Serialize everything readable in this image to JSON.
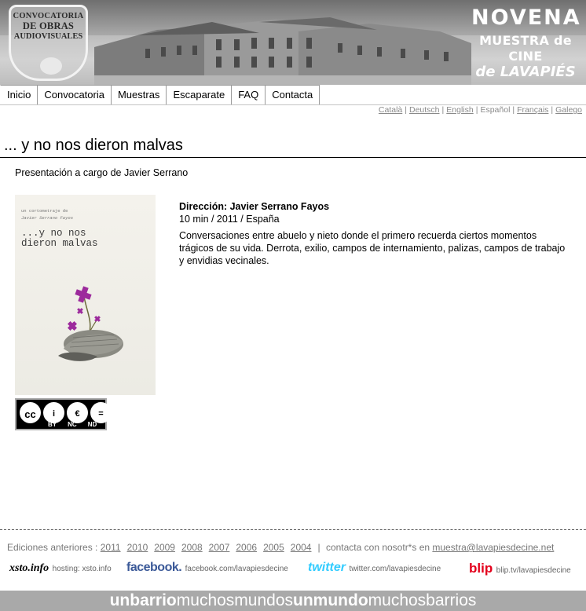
{
  "banner": {
    "badge_line1": "CONVOCATORIA",
    "badge_line2": "DE OBRAS",
    "badge_line3": "AUDIOVISUALES",
    "novena_line1": "NOVENA",
    "novena_line2": "MUESTRA de CINE",
    "novena_line3": "de LAVAPIÉS"
  },
  "nav": {
    "items": [
      {
        "label": "Inicio"
      },
      {
        "label": "Convocatoria"
      },
      {
        "label": "Muestras"
      },
      {
        "label": "Escaparate"
      },
      {
        "label": "FAQ"
      },
      {
        "label": "Contacta"
      }
    ]
  },
  "languages": {
    "items": [
      {
        "label": "Català"
      },
      {
        "label": "Deutsch"
      },
      {
        "label": "English"
      },
      {
        "label": "Español"
      },
      {
        "label": "Français"
      },
      {
        "label": "Galego"
      }
    ],
    "separator": "|"
  },
  "film": {
    "title": "... y no nos dieron malvas",
    "presentation": "Presentación a cargo de Javier Serrano",
    "direction": "Dirección: Javier Serrano Fayos",
    "meta": "10 min / 2011 / España",
    "description": "Conversaciones entre abuelo y nieto donde el primero recuerda ciertos momentos trágicos de su vida. Derrota, exilio, campos de internamiento, palizas, campos de trabajo y envidias vecinales.",
    "poster": {
      "credit_line1": "un cortometraje de",
      "credit_line2": "Javier Serrano Fayos",
      "title": "...y no nos dieron malvas"
    }
  },
  "license": {
    "icons": [
      "cc-icon",
      "by-icon",
      "nc-icon",
      "nd-icon"
    ],
    "symbols": [
      "cc",
      "i",
      "€",
      "="
    ],
    "labels": [
      "BY",
      "NC",
      "ND"
    ]
  },
  "footer": {
    "editions_label": "Ediciones anteriores :",
    "years": [
      "2011",
      "2010",
      "2009",
      "2008",
      "2007",
      "2006",
      "2005",
      "2004"
    ],
    "contact_label": "contacta con nosotr*s en",
    "contact_email": "muestra@lavapiesdecine.net",
    "social": {
      "xsto_logo": "xsto.info",
      "xsto_text": "hosting: xsto.info",
      "facebook_logo": "facebook.",
      "facebook_text": "facebook.com/lavapiesdecine",
      "twitter_logo": "twitter",
      "twitter_text": "twitter.com/lavapiesdecine",
      "blip_logo": "blip",
      "blip_text": "blip.tv/lavapiesdecine"
    },
    "slogan": {
      "p1": "unbarrio",
      "p2": "muchosmundos",
      "p3": "unmundo",
      "p4": "muchosbarrios"
    }
  },
  "colors": {
    "facebook": "#3b5998",
    "twitter": "#33ccff",
    "blip": "#e3001b",
    "poster_accent": "#9c2a9c"
  }
}
